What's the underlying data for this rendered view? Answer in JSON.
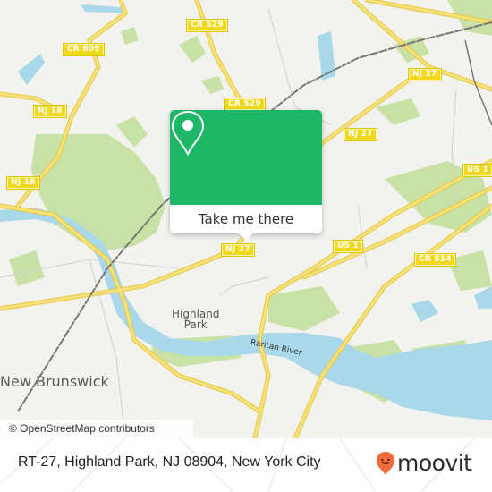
{
  "map": {
    "colors": {
      "land": "#f2f2ee",
      "park": "#c8e2a6",
      "water": "#a8d8ea",
      "major_road": "#f6e27a",
      "road_casing": "#e8c640",
      "minor_road": "#cfcfcf",
      "rail": "#777777",
      "shield_bg": "#f1d81c"
    },
    "shields": [
      {
        "label": "CR 529",
        "id": "cr529-top"
      },
      {
        "label": "CR 609",
        "id": "cr609"
      },
      {
        "label": "NJ 18",
        "id": "nj18-a"
      },
      {
        "label": "NJ 18",
        "id": "nj18-b"
      },
      {
        "label": "CR 529",
        "id": "cr529-mid"
      },
      {
        "label": "NJ 27",
        "id": "nj27-ne"
      },
      {
        "label": "NJ 27",
        "id": "nj27-mid"
      },
      {
        "label": "NJ 27",
        "id": "nj27-sw"
      },
      {
        "label": "US 1",
        "id": "us1-east"
      },
      {
        "label": "US 1",
        "id": "us1-center"
      },
      {
        "label": "CR 514",
        "id": "cr514"
      }
    ],
    "places": {
      "new_brunswick": "New Brunswick",
      "highland_park_line1": "Highland",
      "highland_park_line2": "Park",
      "raritan_river": "Raritan River"
    },
    "attribution": "© OpenStreetMap contributors"
  },
  "popup": {
    "icon": "location-pin-icon",
    "button_label": "Take me there",
    "accent_color": "#1eb768"
  },
  "footer": {
    "address": "RT-27, Highland Park, NJ 08904, New York City",
    "brand": "moovit",
    "brand_color": "#f26b3a"
  }
}
